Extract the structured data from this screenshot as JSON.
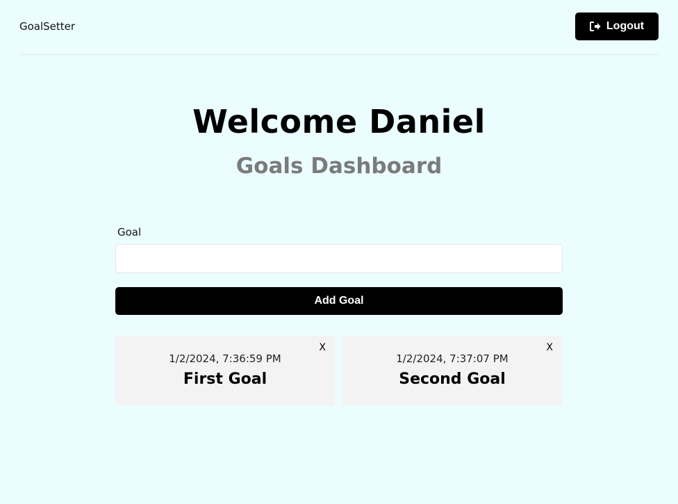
{
  "header": {
    "logo": "GoalSetter",
    "logout_label": "Logout"
  },
  "heading": {
    "welcome": "Welcome Daniel",
    "subtitle": "Goals Dashboard"
  },
  "form": {
    "label": "Goal",
    "input_value": "",
    "submit_label": "Add Goal"
  },
  "goals": [
    {
      "date": "1/2/2024, 7:36:59 PM",
      "title": "First Goal",
      "delete_label": "X"
    },
    {
      "date": "1/2/2024, 7:37:07 PM",
      "title": "Second Goal",
      "delete_label": "X"
    }
  ]
}
